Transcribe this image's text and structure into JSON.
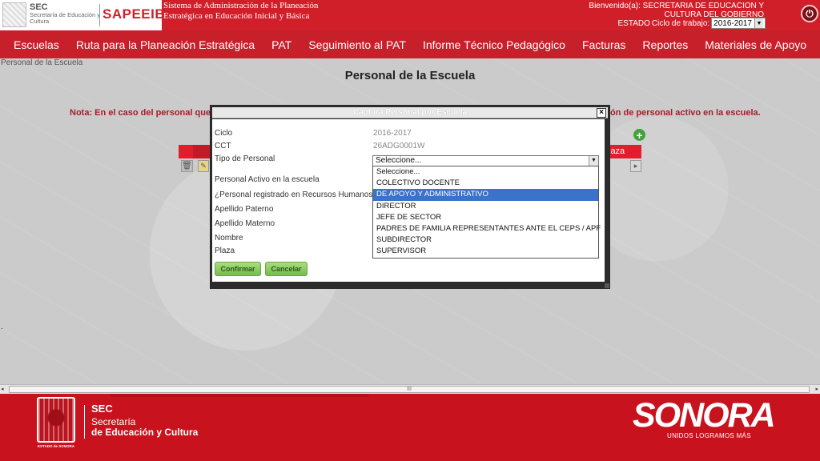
{
  "header": {
    "logo_sec": "SEC",
    "logo_sec_sub": "Secretaría de Educación y Cultura",
    "app_logo": "SAPEEIB",
    "system_title_line1": "Sistema de Administración de la Planeación",
    "system_title_line2": "Estratégica en Educación Inicial y Básica",
    "welcome_line1": "Bienvenido(a): SECRETARIA DE EDUCACION Y",
    "welcome_line2": "CULTURA DEL GOBIERNO",
    "estado_label": "ESTADO",
    "ciclo_label": "Ciclo de trabajo:",
    "ciclo_value": "2016-2017",
    "power_icon": "power-icon"
  },
  "nav": {
    "items": [
      "Escuelas",
      "Ruta para la Planeación Estratégica",
      "PAT",
      "Seguimiento al PAT",
      "Informe Técnico Pedagógico",
      "Facturas",
      "Reportes",
      "Materiales de Apoyo"
    ]
  },
  "page": {
    "breadcrumb": "Personal de la Escuela",
    "title": "Personal de la Escuela",
    "nota_left": "Nota: En el caso del personal que ya",
    "nota_right": "ón de personal activo en la escuela.",
    "table_header_plaza": "laza",
    "dot": "."
  },
  "modal": {
    "title": "Captura Personal por Escuela",
    "close": "×",
    "fields": {
      "ciclo_label": "Ciclo",
      "ciclo_value": "2016-2017",
      "cct_label": "CCT",
      "cct_value": "26ADG0001W",
      "tipo_label": "Tipo de Personal",
      "tipo_value": "Seleccione...",
      "activo_label": "Personal Activo en la escuela",
      "rh_label": "¿Personal registrado en Recursos Humanos?",
      "paterno_label": "Apellido Paterno",
      "materno_label": "Apellido Materno",
      "nombre_label": "Nombre",
      "plaza_label": "Plaza"
    },
    "dropdown_options": [
      "Seleccione...",
      "COLECTIVO DOCENTE",
      "DE APOYO Y ADMINISTRATIVO",
      "DIRECTOR",
      "JEFE DE SECTOR",
      "PADRES DE FAMILIA REPRESENTANTES ANTE EL CEPS / APF",
      "SUBDIRECTOR",
      "SUPERVISOR"
    ],
    "dropdown_highlighted_index": 2,
    "confirm_label": "Confirmar",
    "cancel_label": "Cancelar"
  },
  "scrollbar": {
    "grip": "III",
    "left_arrow": "◂",
    "right_arrow": "▸"
  },
  "footer": {
    "sec": "SEC",
    "sec_sub1": "Secretaría",
    "sec_sub2": "de Educación y Cultura",
    "seal_caption": "ESTADO de SONORA",
    "sonora": "SONORA",
    "sonora_tag": "UNIDOS LOGRAMOS MÁS"
  },
  "colors": {
    "brand_red": "#d11f2a",
    "highlight_blue": "#3a73c9",
    "button_green": "#76bb4c"
  }
}
